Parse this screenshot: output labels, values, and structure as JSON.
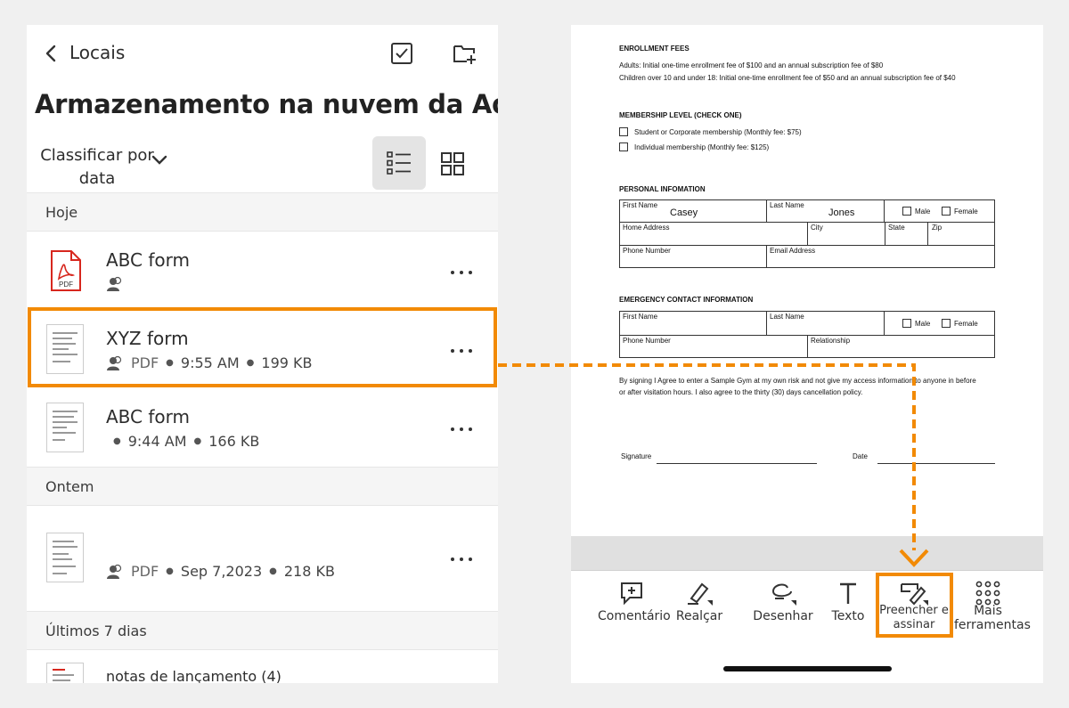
{
  "left": {
    "back_label": "Locais",
    "title": "Armazenamento na nuvem da Adobe",
    "sort_label": "Classificar por data",
    "sections": [
      "Hoje",
      "Ontem",
      "Últimos 7 dias"
    ],
    "files": [
      {
        "name": "ABC form",
        "type": "",
        "time": "",
        "size": ""
      },
      {
        "name": "XYZ form",
        "type": "PDF",
        "time": "9:55 AM",
        "size": "199 KB"
      },
      {
        "name": "ABC form",
        "type": "",
        "time": "9:44 AM",
        "size": "166 KB"
      },
      {
        "name": "",
        "type": "PDF",
        "time": "Sep 7,2023",
        "size": "218 KB"
      },
      {
        "name": "notas de lançamento (4)",
        "type": "",
        "time": "",
        "size": ""
      }
    ],
    "pdf_badge": "PDF"
  },
  "form": {
    "enrollment_title": "ENROLLMENT FEES",
    "enrollment_line1": "Adults: Initial one-time enrollment fee of $100 and an annual subscription fee of $80",
    "enrollment_line2": "Children over 10 and under 18: Initial one-time enrollment fee of $50 and an annual subscription fee of $40",
    "membership_title": "MEMBERSHIP LEVEL (CHECK ONE)",
    "membership_opt1": "Student or Corporate membership (Monthly fee: $75)",
    "membership_opt2": "Individual membership (Monthly fee: $125)",
    "personal_title": "PERSONAL INFOMATION",
    "first_name_label": "First Name",
    "first_name_value": "Casey",
    "last_name_label": "Last Name",
    "last_name_value": "Jones",
    "male_label": "Male",
    "female_label": "Female",
    "home_address_label": "Home Address",
    "city_label": "City",
    "state_label": "State",
    "zip_label": "Zip",
    "phone_label": "Phone Number",
    "email_label": "Email Address",
    "emergency_title": "EMERGENCY CONTACT INFORMATION",
    "relationship_label": "Relationship",
    "agreement_line1": "By signing I Agree to enter a Sample Gym at my own risk and not give my access information to anyone in before",
    "agreement_line2": "or after visitation hours. I also agree to the thirty (30) days cancellation policy.",
    "signature_label": "Signature",
    "date_label": "Date"
  },
  "toolbar": {
    "comment": "Comentário",
    "highlight": "Realçar",
    "draw": "Desenhar",
    "text": "Texto",
    "fill_sign_1": "Preencher e",
    "fill_sign_2": "assinar",
    "more_1": "Mais",
    "more_2": "ferramentas"
  },
  "colors": {
    "accent_orange": "#f28a05",
    "pdf_red": "#d7271e"
  }
}
